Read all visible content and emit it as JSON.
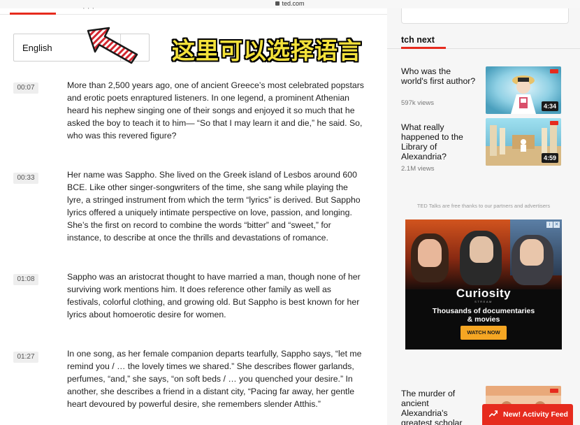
{
  "browser": {
    "url": "ted.com"
  },
  "left": {
    "tab_hint": "· · ·",
    "language_select": {
      "value": "English"
    },
    "segments": [
      {
        "time": "00:07",
        "text": "More than 2,500 years ago, one of ancient Greece’s most celebrated popstars and erotic poets enraptured listeners. In one legend, a prominent Athenian heard his nephew singing one of their songs and enjoyed it so much that he asked the boy to teach it to him— “So that I may learn it and die,” he said. So, who was this revered figure?"
      },
      {
        "time": "00:33",
        "text": "Her name was Sappho. She lived on the Greek island of Lesbos around 600 BCE. Like other singer-songwriters of the time, she sang while playing the lyre, a stringed instrument from which the term “lyrics” is derived. But Sappho lyrics offered a uniquely intimate perspective on love, passion, and longing. She’s the first on record to combine the words “bitter” and “sweet,” for instance, to describe at once the thrills and devastations of romance."
      },
      {
        "time": "01:08",
        "text": "Sappho was an aristocrat thought to have married a man, though none of her surviving work mentions him. It does reference other family as well as festivals, colorful clothing, and growing old. But Sappho is best known for her lyrics about homoerotic desire for women."
      },
      {
        "time": "01:27",
        "text": "In one song, as her female companion departs tearfully, Sappho says, “let me remind you / … the lovely times we shared.” She describes flower garlands, perfumes, “and,” she says, “on soft beds / … you quenched your desire.” In another, she describes a friend in a distant city, “Pacing far away, her gentle heart devoured by powerful desire, she remembers slender Atthis.”"
      }
    ]
  },
  "sidebar": {
    "watch_next": "tch next",
    "cards": [
      {
        "title": "Who was the world's first author?",
        "views": "597k views",
        "duration": "4:34"
      },
      {
        "title": "What really happened to the Library of Alexandria?",
        "views": "2.1M views",
        "duration": "4:59"
      },
      {
        "title": "The murder of ancient Alexandria's greatest scholar",
        "views": "",
        "duration": ""
      }
    ],
    "ad_note": "TED Talks are free thanks to our partners and advertisers",
    "ad": {
      "brand": "Curiosity",
      "sub": "STREAM",
      "line1": "Thousands of documentaries",
      "line2": "& movies",
      "cta": "WATCH NOW"
    },
    "feed_button": "New! Activity Feed"
  },
  "overlay": {
    "caption": "这里可以选择语言"
  },
  "colors": {
    "ted_red": "#e62b1e",
    "caption_yellow": "#f3e13a",
    "cta_orange": "#f5a623"
  }
}
